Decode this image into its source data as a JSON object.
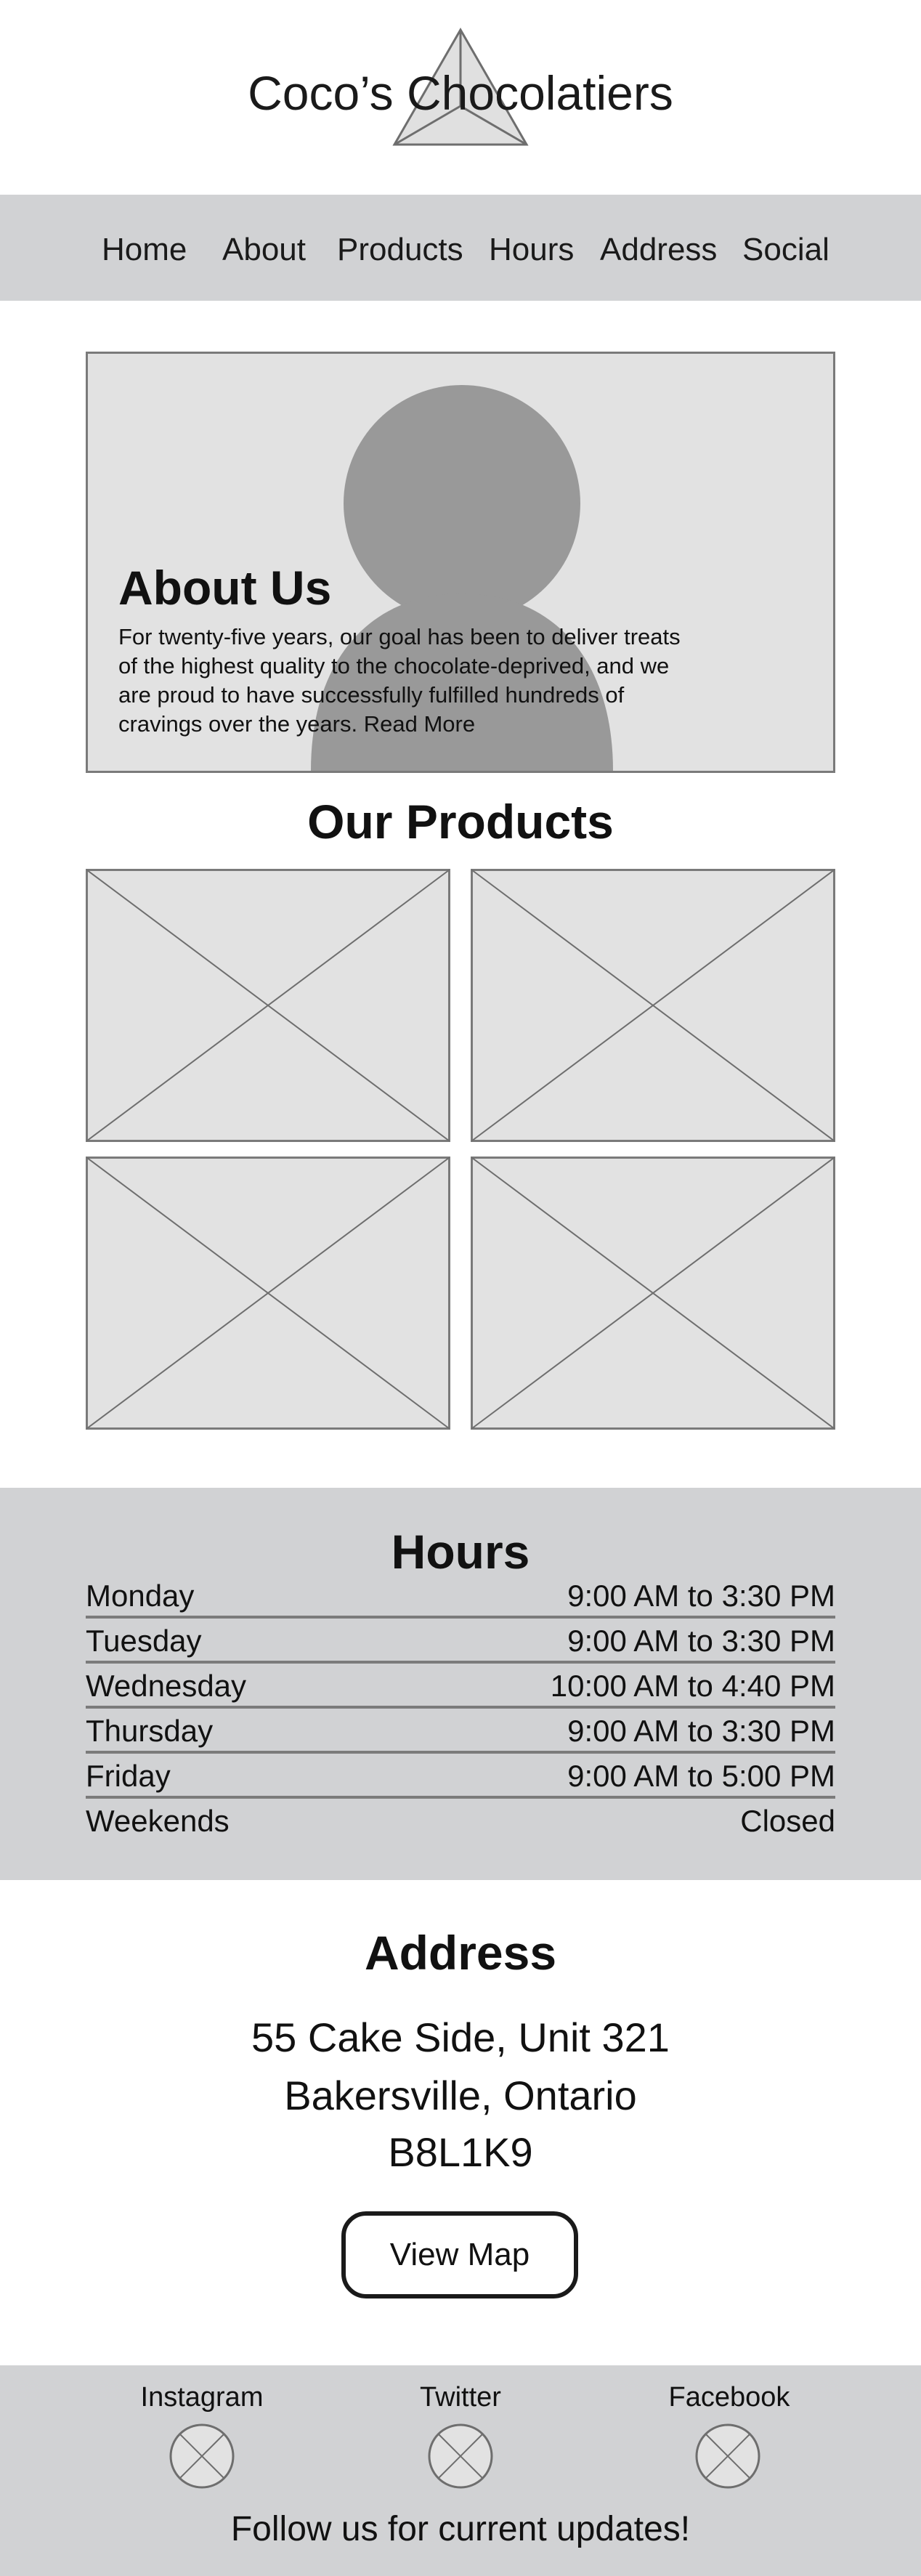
{
  "brand": {
    "name": "Coco’s Chocolatiers"
  },
  "nav": {
    "items": [
      {
        "label": "Home"
      },
      {
        "label": "About"
      },
      {
        "label": "Products"
      },
      {
        "label": "Hours"
      },
      {
        "label": "Address"
      },
      {
        "label": "Social"
      }
    ]
  },
  "about": {
    "title": "About Us",
    "body": "For twenty-five years, our goal has been to deliver treats of the highest quality to the chocolate-deprived, and we are proud to have successfully fulfilled hundreds of cravings over the years.",
    "read_more": "Read More"
  },
  "products": {
    "title": "Our Products",
    "tiles": [
      {
        "icon": "image-placeholder-icon"
      },
      {
        "icon": "image-placeholder-icon"
      },
      {
        "icon": "image-placeholder-icon"
      },
      {
        "icon": "image-placeholder-icon"
      }
    ]
  },
  "hours": {
    "title": "Hours",
    "rows": [
      {
        "day": "Monday",
        "time": "9:00 AM to 3:30 PM"
      },
      {
        "day": "Tuesday",
        "time": "9:00 AM to 3:30 PM"
      },
      {
        "day": "Wednesday",
        "time": "10:00 AM to 4:40 PM"
      },
      {
        "day": "Thursday",
        "time": "9:00 AM to 3:30 PM"
      },
      {
        "day": "Friday",
        "time": "9:00 AM to 5:00 PM"
      },
      {
        "day": "Weekends",
        "time": "Closed"
      }
    ]
  },
  "address": {
    "title": "Address",
    "lines": [
      "55 Cake Side, Unit 321",
      "Bakersville, Ontario",
      "B8L1K9"
    ],
    "map_button": "View Map"
  },
  "social": {
    "links": [
      {
        "label": "Instagram",
        "icon": "instagram-placeholder-icon"
      },
      {
        "label": "Twitter",
        "icon": "twitter-placeholder-icon"
      },
      {
        "label": "Facebook",
        "icon": "facebook-placeholder-icon"
      }
    ],
    "footer_text": "Follow us for current updates!"
  },
  "colors": {
    "band_gray": "#d1d2d4",
    "placeholder_fill": "#e2e2e2",
    "avatar_gray": "#999999",
    "outline": "#7a7a7a"
  }
}
